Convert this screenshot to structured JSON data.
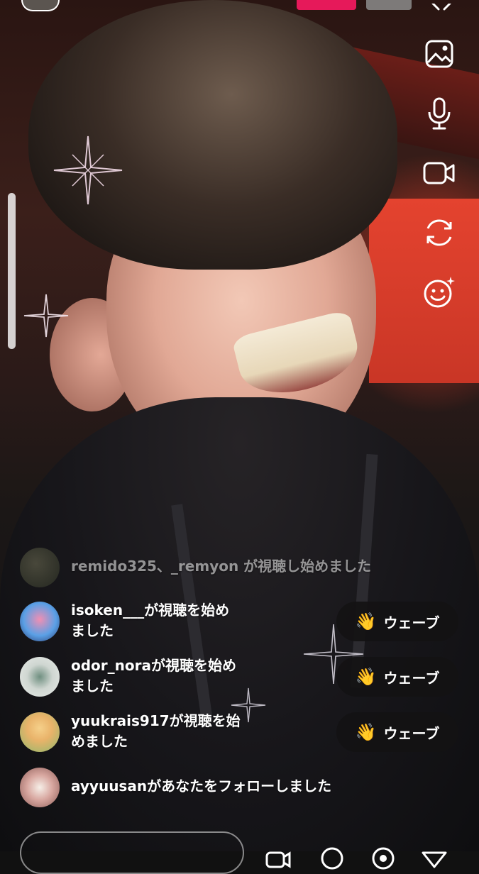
{
  "live": {
    "controls": [
      {
        "name": "gallery-icon"
      },
      {
        "name": "microphone-icon"
      },
      {
        "name": "video-camera-icon"
      },
      {
        "name": "flip-camera-icon"
      },
      {
        "name": "effects-icon"
      }
    ]
  },
  "comments": [
    {
      "user_text": "remido325、_remyon が視聴し始めました",
      "wave": false,
      "dim": true
    },
    {
      "user_text_line1": "isoken___が視聴を始め",
      "user_text_line2": "ました",
      "wave_label": "ウェーブ"
    },
    {
      "user_text_line1": "odor_noraが視聴を始め",
      "user_text_line2": "ました",
      "wave_label": "ウェーブ"
    },
    {
      "user_text_line1": "yuukrais917が視聴を始",
      "user_text_line2": "めました",
      "wave_label": "ウェーブ"
    },
    {
      "user_text": "ayyuusanがあなたをフォローしました"
    }
  ],
  "colors": {
    "live_badge": "#e6195a",
    "accent_red": "#e4432f"
  }
}
